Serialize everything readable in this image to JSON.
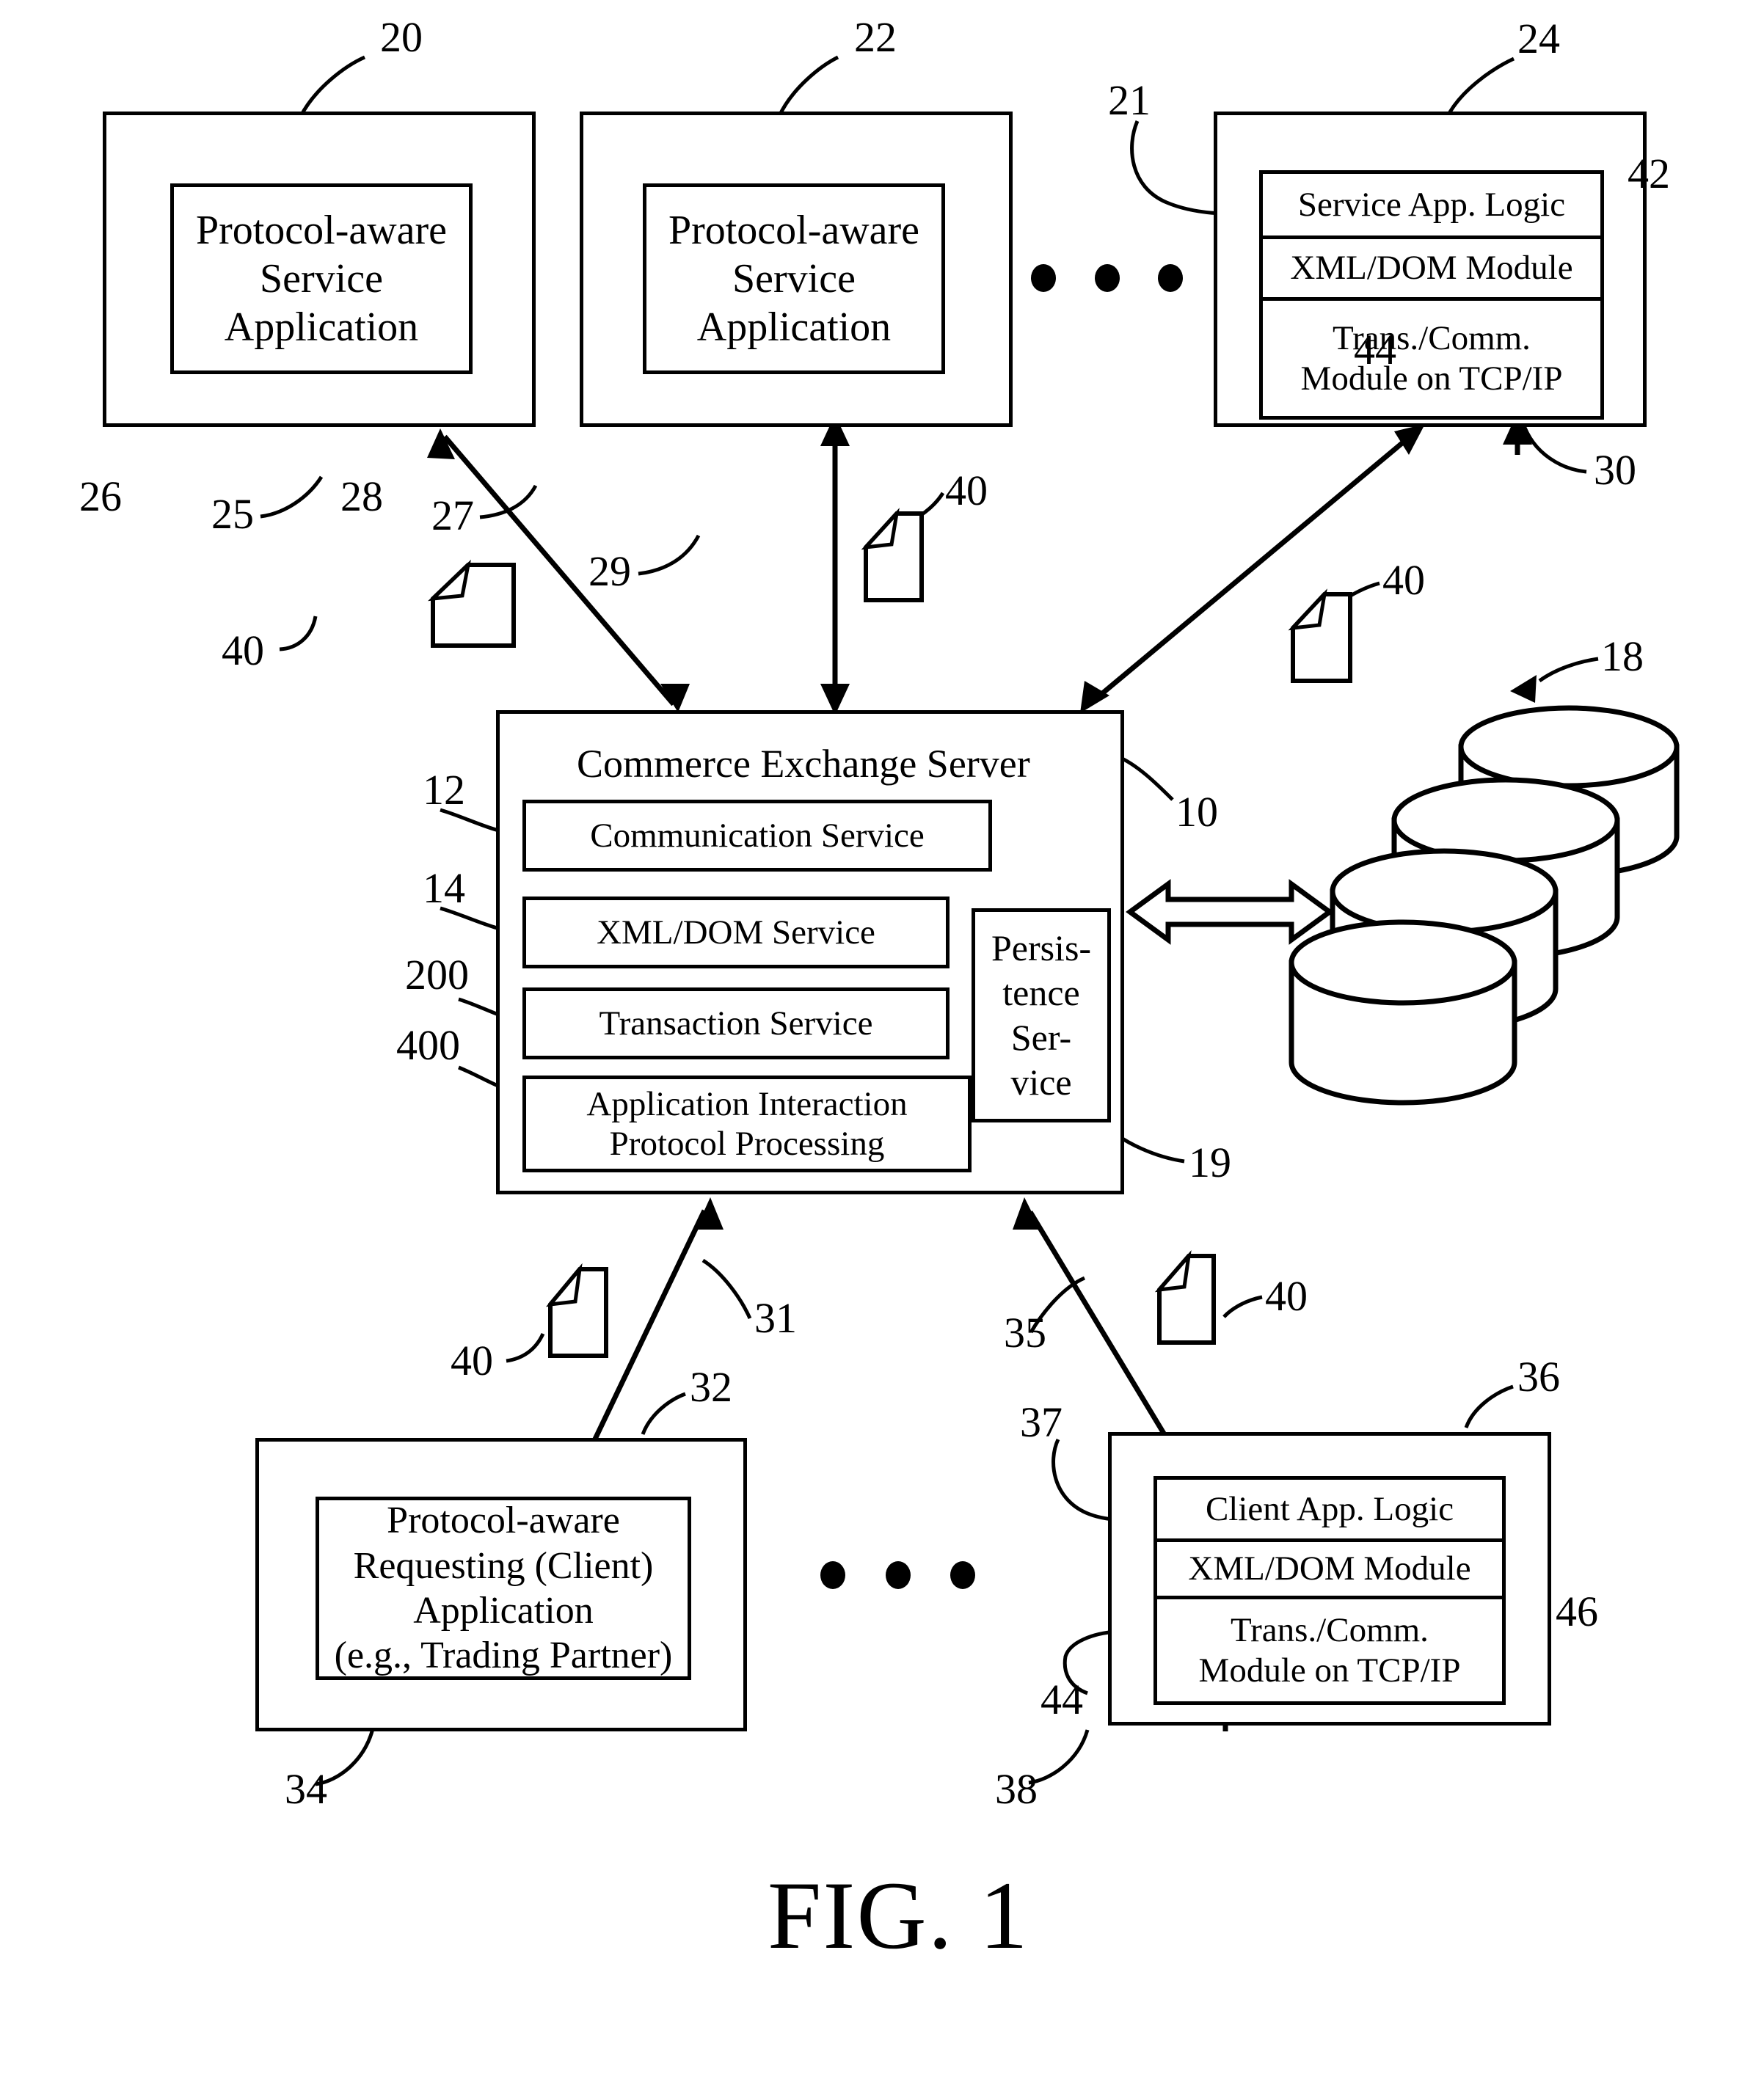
{
  "figure": {
    "caption": "FIG. 1"
  },
  "top_nodes": [
    {
      "ref_outer": "20",
      "ref_inner": "26",
      "label": "Protocol-aware\nService\nApplication"
    },
    {
      "ref_outer": "22",
      "ref_inner": "28",
      "label": "Protocol-aware\nService\nApplication"
    }
  ],
  "service_node": {
    "ref_outer": "24",
    "ref_logic": "21",
    "ref_xml": "42",
    "ref_trans": "44",
    "ref_arrow": "30",
    "rows": [
      "Service App. Logic",
      "XML/DOM Module",
      "Trans./Comm.\nModule on TCP/IP"
    ]
  },
  "server": {
    "ref": "10",
    "title": "Commerce Exchange Server",
    "services": [
      {
        "ref": "12",
        "label": "Communication Service"
      },
      {
        "ref": "14",
        "label": "XML/DOM Service"
      },
      {
        "ref": "200",
        "label": "Transaction Service"
      },
      {
        "ref": "400",
        "label": "Application Interaction\nProtocol Processing"
      }
    ],
    "persistence": {
      "ref": "19",
      "label": "Persis-\ntence\nSer-\nvice"
    }
  },
  "database": {
    "ref": "18",
    "cylinder_count": 4
  },
  "client_node": {
    "ref_outer": "32",
    "ref_inner": "34",
    "label": "Protocol-aware\nRequesting (Client)\nApplication\n(e.g., Trading Partner)"
  },
  "client_stack": {
    "ref_outer": "36",
    "ref_logic": "37",
    "ref_xml": "46",
    "ref_trans": "44",
    "ref_arrow": "38",
    "rows": [
      "Client App. Logic",
      "XML/DOM Module",
      "Trans./Comm.\nModule on TCP/IP"
    ]
  },
  "connections": [
    {
      "ref": "25"
    },
    {
      "ref": "27"
    },
    {
      "ref": "29"
    },
    {
      "ref": "31"
    },
    {
      "ref": "35"
    }
  ],
  "documents": [
    {
      "ref": "40"
    },
    {
      "ref": "40"
    },
    {
      "ref": "40"
    },
    {
      "ref": "40"
    },
    {
      "ref": "40"
    }
  ],
  "ellipsis": {
    "top_dots": 3,
    "bottom_dots": 3
  },
  "colors": {
    "ink": "#000000",
    "paper": "#ffffff"
  }
}
